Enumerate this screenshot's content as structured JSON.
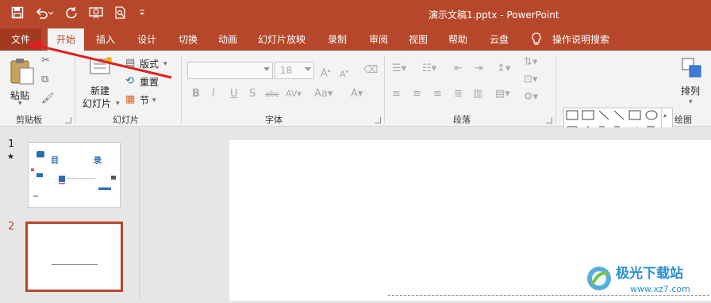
{
  "window": {
    "title": "演示文稿1.pptx  -  PowerPoint",
    "titlebar_color": "#b7472a"
  },
  "qat": {
    "icons": [
      "save-icon",
      "undo-icon",
      "redo-icon",
      "slideshow-icon",
      "preview-icon",
      "customize-icon"
    ]
  },
  "tabs": [
    {
      "label": "文件"
    },
    {
      "label": "开始"
    },
    {
      "label": "插入"
    },
    {
      "label": "设计"
    },
    {
      "label": "切换"
    },
    {
      "label": "动画"
    },
    {
      "label": "幻灯片放映"
    },
    {
      "label": "录制"
    },
    {
      "label": "审阅"
    },
    {
      "label": "视图"
    },
    {
      "label": "帮助"
    },
    {
      "label": "云盘"
    }
  ],
  "tell_me": "操作说明搜索",
  "ribbon": {
    "clipboard": {
      "paste": "粘贴",
      "group": "剪贴板"
    },
    "slides": {
      "new_slide_line1": "新建",
      "new_slide_line2": "幻灯片",
      "layout": "版式",
      "reset": "重置",
      "section": "节",
      "group": "幻灯片"
    },
    "font": {
      "font_name": "",
      "font_size": "18",
      "group": "字体"
    },
    "paragraph": {
      "group": "段落"
    },
    "drawing": {
      "arrange": "排列",
      "group": "绘图"
    }
  },
  "slides": [
    {
      "number": "1",
      "star": "★",
      "title_left": "目",
      "title_right": "录"
    },
    {
      "number": "2"
    }
  ],
  "watermark": {
    "text": "极光下载站",
    "url": "www.xz7.com"
  }
}
